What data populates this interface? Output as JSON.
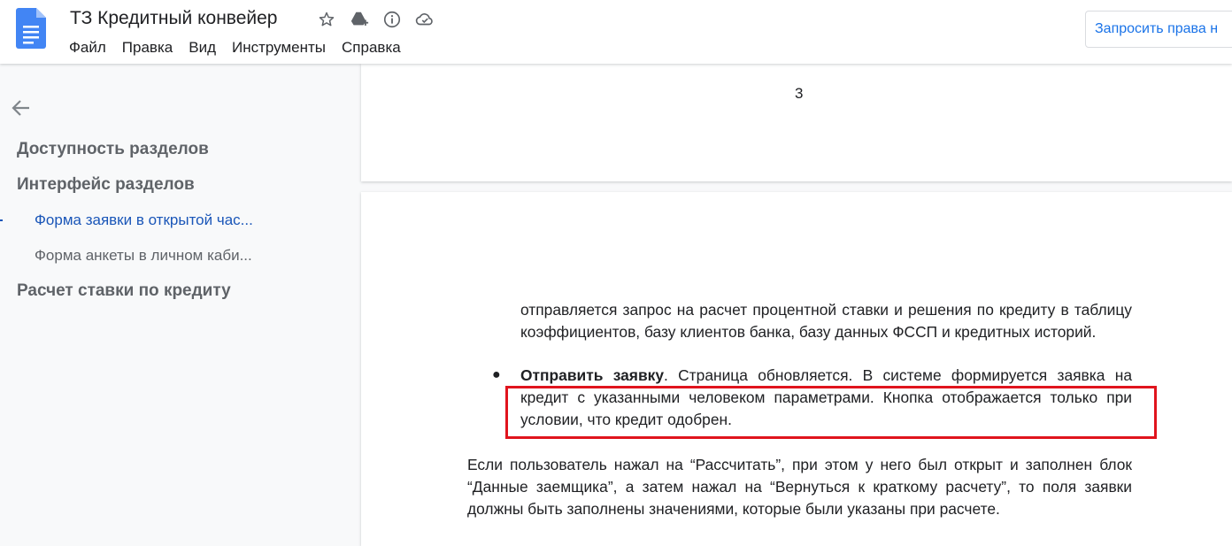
{
  "header": {
    "title": "ТЗ Кредитный конвейер",
    "menu": [
      "Файл",
      "Правка",
      "Вид",
      "Инструменты",
      "Справка"
    ],
    "request_button": "Запросить права н",
    "icons": [
      "star-icon",
      "drive-add-icon",
      "info-icon",
      "cloud-saved-icon"
    ]
  },
  "outline": {
    "items": [
      {
        "label": "Доступность разделов",
        "level": 1
      },
      {
        "label": "Интерфейс разделов",
        "level": 1
      },
      {
        "label": "Форма заявки в открытой час...",
        "level": 2,
        "active": true
      },
      {
        "label": "Форма анкеты в личном каби...",
        "level": 2
      },
      {
        "label": "Расчет ставки по кредиту",
        "level": 1
      }
    ]
  },
  "document": {
    "page_number": "3",
    "para1": "отправляется запрос на расчет процентной ставки и решения по кредиту в таблицу коэффициентов, базу клиентов банка, базу данных ФССП и кредитных историй.",
    "bullet_bold": "Отправить заявку",
    "bullet_rest1": ". Страница обновляется. В системе формируется заявка на",
    "bullet_rest2": "кредит с указанными человеком параметрами. Кнопка отображается только при условии, что кредит одобрен.",
    "para2": "Если пользователь нажал на “Рассчитать”, при этом у него был открыт и заполнен блок “Данные заемщика”, а затем нажал на “Вернуться к краткому расчету”, то поля заявки должны быть заполнены значениями, которые были указаны при расчете."
  },
  "colors": {
    "accent": "#1a73e8",
    "highlight_border": "#e0141d",
    "doc_icon": "#4285f4"
  }
}
